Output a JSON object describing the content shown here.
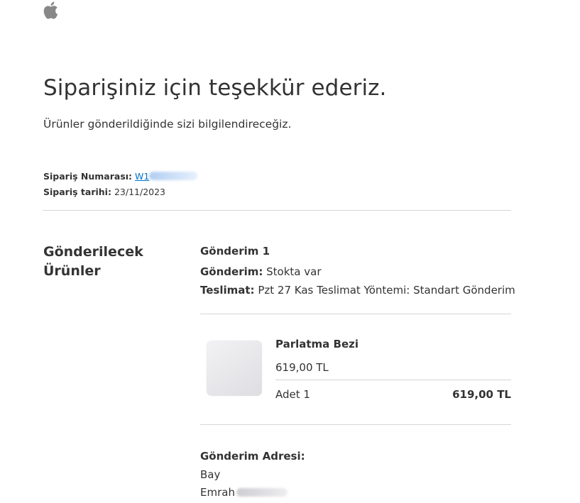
{
  "header": {
    "logo": "apple-logo"
  },
  "confirmation": {
    "title": "Siparişiniz için teşekkür ederiz.",
    "subtitle": "Ürünler gönderildiğinde sizi bilgilendireceğiz."
  },
  "order": {
    "number_label": "Sipariş Numarası:",
    "number_visible": "W1",
    "date_label": "Sipariş tarihi:",
    "date_value": "23/11/2023"
  },
  "section": {
    "heading": "Gönderilecek Ürünler"
  },
  "shipment": {
    "heading": "Gönderim 1",
    "status_label": "Gönderim:",
    "status_value": "Stokta var",
    "delivery_label": "Teslimat:",
    "delivery_value": "Pzt 27 Kas Teslimat Yöntemi: Standart Gönderim"
  },
  "product": {
    "name": "Parlatma Bezi",
    "unit_price": "619,00 TL",
    "quantity_label": "Adet 1",
    "line_total": "619,00 TL"
  },
  "address": {
    "heading": "Gönderim Adresi:",
    "title": "Bay",
    "first_name": "Emrah"
  },
  "colors": {
    "text": "#333333",
    "link": "#0070c9",
    "divider": "#d6d6d6"
  }
}
